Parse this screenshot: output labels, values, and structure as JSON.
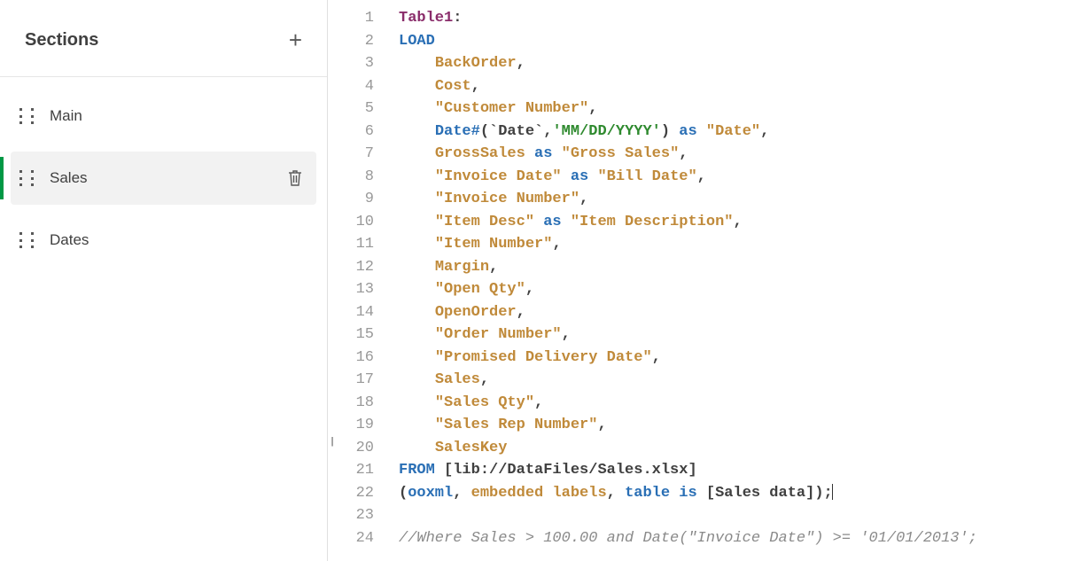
{
  "sidebar": {
    "title": "Sections",
    "items": [
      {
        "label": "Main",
        "selected": false,
        "showDelete": false
      },
      {
        "label": "Sales",
        "selected": true,
        "showDelete": true
      },
      {
        "label": "Dates",
        "selected": false,
        "showDelete": false
      }
    ]
  },
  "editor": {
    "lines": [
      {
        "n": "1",
        "tokens": [
          {
            "t": "Table1",
            "c": "t-label"
          },
          {
            "t": ":",
            "c": "t-punct"
          }
        ]
      },
      {
        "n": "2",
        "tokens": [
          {
            "t": "LOAD",
            "c": "t-keyword"
          }
        ]
      },
      {
        "n": "3",
        "tokens": [
          {
            "t": "    "
          },
          {
            "t": "BackOrder",
            "c": "t-field"
          },
          {
            "t": ",",
            "c": "t-punct"
          }
        ]
      },
      {
        "n": "4",
        "tokens": [
          {
            "t": "    "
          },
          {
            "t": "Cost",
            "c": "t-field"
          },
          {
            "t": ",",
            "c": "t-punct"
          }
        ]
      },
      {
        "n": "5",
        "tokens": [
          {
            "t": "    "
          },
          {
            "t": "\"Customer Number\"",
            "c": "t-field"
          },
          {
            "t": ",",
            "c": "t-punct"
          }
        ]
      },
      {
        "n": "6",
        "tokens": [
          {
            "t": "    "
          },
          {
            "t": "Date#",
            "c": "t-op"
          },
          {
            "t": "(",
            "c": "t-punct"
          },
          {
            "t": "`Date`",
            "c": "t-tick"
          },
          {
            "t": ",",
            "c": "t-punct"
          },
          {
            "t": "'MM/DD/YYYY'",
            "c": "t-string"
          },
          {
            "t": ")",
            "c": "t-punct"
          },
          {
            "t": " "
          },
          {
            "t": "as",
            "c": "t-op"
          },
          {
            "t": " "
          },
          {
            "t": "\"Date\"",
            "c": "t-field"
          },
          {
            "t": ",",
            "c": "t-punct"
          }
        ]
      },
      {
        "n": "7",
        "tokens": [
          {
            "t": "    "
          },
          {
            "t": "GrossSales",
            "c": "t-field"
          },
          {
            "t": " "
          },
          {
            "t": "as",
            "c": "t-op"
          },
          {
            "t": " "
          },
          {
            "t": "\"Gross Sales\"",
            "c": "t-field"
          },
          {
            "t": ",",
            "c": "t-punct"
          }
        ]
      },
      {
        "n": "8",
        "tokens": [
          {
            "t": "    "
          },
          {
            "t": "\"Invoice Date\"",
            "c": "t-field"
          },
          {
            "t": " "
          },
          {
            "t": "as",
            "c": "t-op"
          },
          {
            "t": " "
          },
          {
            "t": "\"Bill Date\"",
            "c": "t-field"
          },
          {
            "t": ",",
            "c": "t-punct"
          }
        ]
      },
      {
        "n": "9",
        "tokens": [
          {
            "t": "    "
          },
          {
            "t": "\"Invoice Number\"",
            "c": "t-field"
          },
          {
            "t": ",",
            "c": "t-punct"
          }
        ]
      },
      {
        "n": "10",
        "tokens": [
          {
            "t": "    "
          },
          {
            "t": "\"Item Desc\"",
            "c": "t-field"
          },
          {
            "t": " "
          },
          {
            "t": "as",
            "c": "t-op"
          },
          {
            "t": " "
          },
          {
            "t": "\"Item Description\"",
            "c": "t-field"
          },
          {
            "t": ",",
            "c": "t-punct"
          }
        ]
      },
      {
        "n": "11",
        "tokens": [
          {
            "t": "    "
          },
          {
            "t": "\"Item Number\"",
            "c": "t-field"
          },
          {
            "t": ",",
            "c": "t-punct"
          }
        ]
      },
      {
        "n": "12",
        "tokens": [
          {
            "t": "    "
          },
          {
            "t": "Margin",
            "c": "t-field"
          },
          {
            "t": ",",
            "c": "t-punct"
          }
        ]
      },
      {
        "n": "13",
        "tokens": [
          {
            "t": "    "
          },
          {
            "t": "\"Open Qty\"",
            "c": "t-field"
          },
          {
            "t": ",",
            "c": "t-punct"
          }
        ]
      },
      {
        "n": "14",
        "tokens": [
          {
            "t": "    "
          },
          {
            "t": "OpenOrder",
            "c": "t-field"
          },
          {
            "t": ",",
            "c": "t-punct"
          }
        ]
      },
      {
        "n": "15",
        "tokens": [
          {
            "t": "    "
          },
          {
            "t": "\"Order Number\"",
            "c": "t-field"
          },
          {
            "t": ",",
            "c": "t-punct"
          }
        ]
      },
      {
        "n": "16",
        "tokens": [
          {
            "t": "    "
          },
          {
            "t": "\"Promised Delivery Date\"",
            "c": "t-field"
          },
          {
            "t": ",",
            "c": "t-punct"
          }
        ]
      },
      {
        "n": "17",
        "tokens": [
          {
            "t": "    "
          },
          {
            "t": "Sales",
            "c": "t-field"
          },
          {
            "t": ",",
            "c": "t-punct"
          }
        ]
      },
      {
        "n": "18",
        "tokens": [
          {
            "t": "    "
          },
          {
            "t": "\"Sales Qty\"",
            "c": "t-field"
          },
          {
            "t": ",",
            "c": "t-punct"
          }
        ]
      },
      {
        "n": "19",
        "tokens": [
          {
            "t": "    "
          },
          {
            "t": "\"Sales Rep Number\"",
            "c": "t-field"
          },
          {
            "t": ",",
            "c": "t-punct"
          }
        ]
      },
      {
        "n": "20",
        "tokens": [
          {
            "t": "    "
          },
          {
            "t": "SalesKey",
            "c": "t-field"
          }
        ]
      },
      {
        "n": "21",
        "tokens": [
          {
            "t": "FROM",
            "c": "t-keyword"
          },
          {
            "t": " "
          },
          {
            "t": "[lib://DataFiles/Sales.xlsx]",
            "c": "t-path"
          }
        ]
      },
      {
        "n": "22",
        "tokens": [
          {
            "t": "(",
            "c": "t-punct"
          },
          {
            "t": "ooxml",
            "c": "t-op"
          },
          {
            "t": ", ",
            "c": "t-punct"
          },
          {
            "t": "embedded labels",
            "c": "t-field"
          },
          {
            "t": ", ",
            "c": "t-punct"
          },
          {
            "t": "table is",
            "c": "t-op"
          },
          {
            "t": " "
          },
          {
            "t": "[Sales data]",
            "c": "t-path"
          },
          {
            "t": ");",
            "c": "t-punct"
          },
          {
            "t": "",
            "c": "t-cursor"
          }
        ]
      },
      {
        "n": "23",
        "tokens": []
      },
      {
        "n": "24",
        "tokens": [
          {
            "t": "//Where Sales > 100.00 and Date(\"Invoice Date\") >= '01/01/2013';",
            "c": "t-comment"
          }
        ]
      }
    ]
  }
}
